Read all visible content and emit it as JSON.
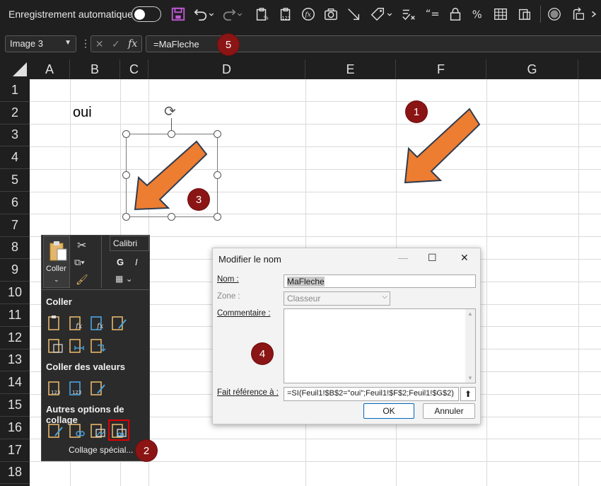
{
  "qat": {
    "autosave_label": "Enregistrement automatique",
    "icons": [
      "save-icon",
      "undo-icon",
      "redo-icon",
      "paste-formula-icon",
      "paste-values-icon",
      "function-icon",
      "camera-icon",
      "arrow-line-icon",
      "tag-icon",
      "spellcheck-icon",
      "quote-icon",
      "lock-icon",
      "percent-icon",
      "table-format-icon",
      "sheet-copy-icon",
      "record-icon",
      "share-icon",
      "more-icon"
    ]
  },
  "formula_bar": {
    "name_box": "Image 3",
    "formula": "=MaFleche",
    "fx_label": "fx"
  },
  "columns": [
    "A",
    "B",
    "C",
    "D",
    "E",
    "F",
    "G"
  ],
  "rows": [
    "1",
    "2",
    "3",
    "4",
    "5",
    "6",
    "7",
    "8",
    "9",
    "10",
    "11",
    "12",
    "13",
    "14",
    "15",
    "16",
    "17",
    "18"
  ],
  "cells": {
    "B2": "oui"
  },
  "badges": [
    "1",
    "2",
    "3",
    "4",
    "5"
  ],
  "ribbon_fragment": {
    "paste_label": "Coller",
    "font_name": "Calibri",
    "bold": "G",
    "italic": "I"
  },
  "paste_menu": {
    "section_paste": "Coller",
    "section_values": "Coller des valeurs",
    "section_other": "Autres options de collage",
    "special": "Collage spécial..."
  },
  "dialog": {
    "title": "Modifier le nom",
    "name_label": "Nom :",
    "name_value": "MaFleche",
    "zone_label": "Zone :",
    "zone_value": "Classeur",
    "comment_label": "Commentaire :",
    "ref_label": "Fait référence à :",
    "ref_value": "=SI(Feuil1!$B$2=\"oui\";Feuil1!$F$2;Feuil1!$G$2)",
    "ok": "OK",
    "cancel": "Annuler"
  },
  "colors": {
    "accent_badge": "#8b1414",
    "arrow_fill": "#ed7d31",
    "arrow_stroke": "#2f3b4f",
    "highlight": "#e00000"
  }
}
